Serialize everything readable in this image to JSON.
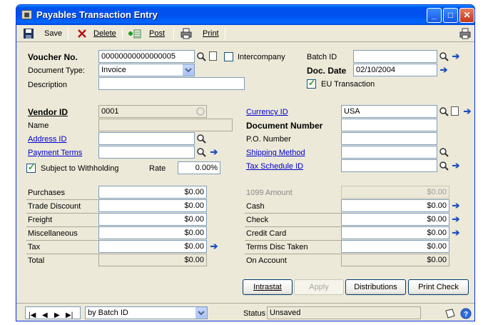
{
  "window": {
    "title": "Payables Transaction Entry",
    "controls": {
      "minimize": "_",
      "maximize": "□",
      "close": "✕"
    }
  },
  "toolbar": {
    "save": "Save",
    "delete": "Delete",
    "post": "Post",
    "print": "Print"
  },
  "header": {
    "voucher_label": "Voucher No.",
    "voucher_value": "00000000000000005",
    "intercompany_label": "Intercompany",
    "batch_label": "Batch ID",
    "batch_value": "",
    "doctype_label": "Document Type:",
    "doctype_value": "Invoice",
    "docdate_label": "Doc. Date",
    "docdate_value": "02/10/2004",
    "description_label": "Description",
    "description_value": "",
    "eu_label": "EU Transaction"
  },
  "vendor": {
    "vendor_label": "Vendor ID",
    "vendor_value": "0001",
    "name_label": "Name",
    "name_value": "",
    "address_label": "Address ID",
    "address_value": "",
    "terms_label": "Payment Terms",
    "terms_value": "",
    "withholding_label": "Subject to Withholding",
    "rate_label": "Rate",
    "rate_value": "0.00%"
  },
  "right": {
    "currency_label": "Currency ID",
    "currency_value": "USA",
    "docnum_label": "Document Number",
    "docnum_value": "",
    "po_label": "P.O. Number",
    "po_value": "",
    "shipping_label": "Shipping Method",
    "shipping_value": "",
    "taxsched_label": "Tax Schedule ID",
    "taxsched_value": ""
  },
  "amounts_left": [
    {
      "label": "Purchases",
      "value": "$0.00"
    },
    {
      "label": "Trade Discount",
      "value": "$0.00"
    },
    {
      "label": "Freight",
      "value": "$0.00"
    },
    {
      "label": "Miscellaneous",
      "value": "$0.00"
    },
    {
      "label": "Tax",
      "value": "$0.00"
    },
    {
      "label": "Total",
      "value": "$0.00"
    }
  ],
  "amounts_right": [
    {
      "label": "1099 Amount",
      "value": "$0.00"
    },
    {
      "label": "Cash",
      "value": "$0.00"
    },
    {
      "label": "Check",
      "value": "$0.00"
    },
    {
      "label": "Credit Card",
      "value": "$0.00"
    },
    {
      "label": "Terms Disc Taken",
      "value": "$0.00"
    },
    {
      "label": "On Account",
      "value": "$0.00"
    }
  ],
  "buttons": {
    "intrastat": "Intrastat",
    "apply": "Apply",
    "distributions": "Distributions",
    "print_check": "Print Check"
  },
  "statusbar": {
    "sort_value": "by Batch ID",
    "status_label": "Status",
    "status_value": "Unsaved"
  }
}
